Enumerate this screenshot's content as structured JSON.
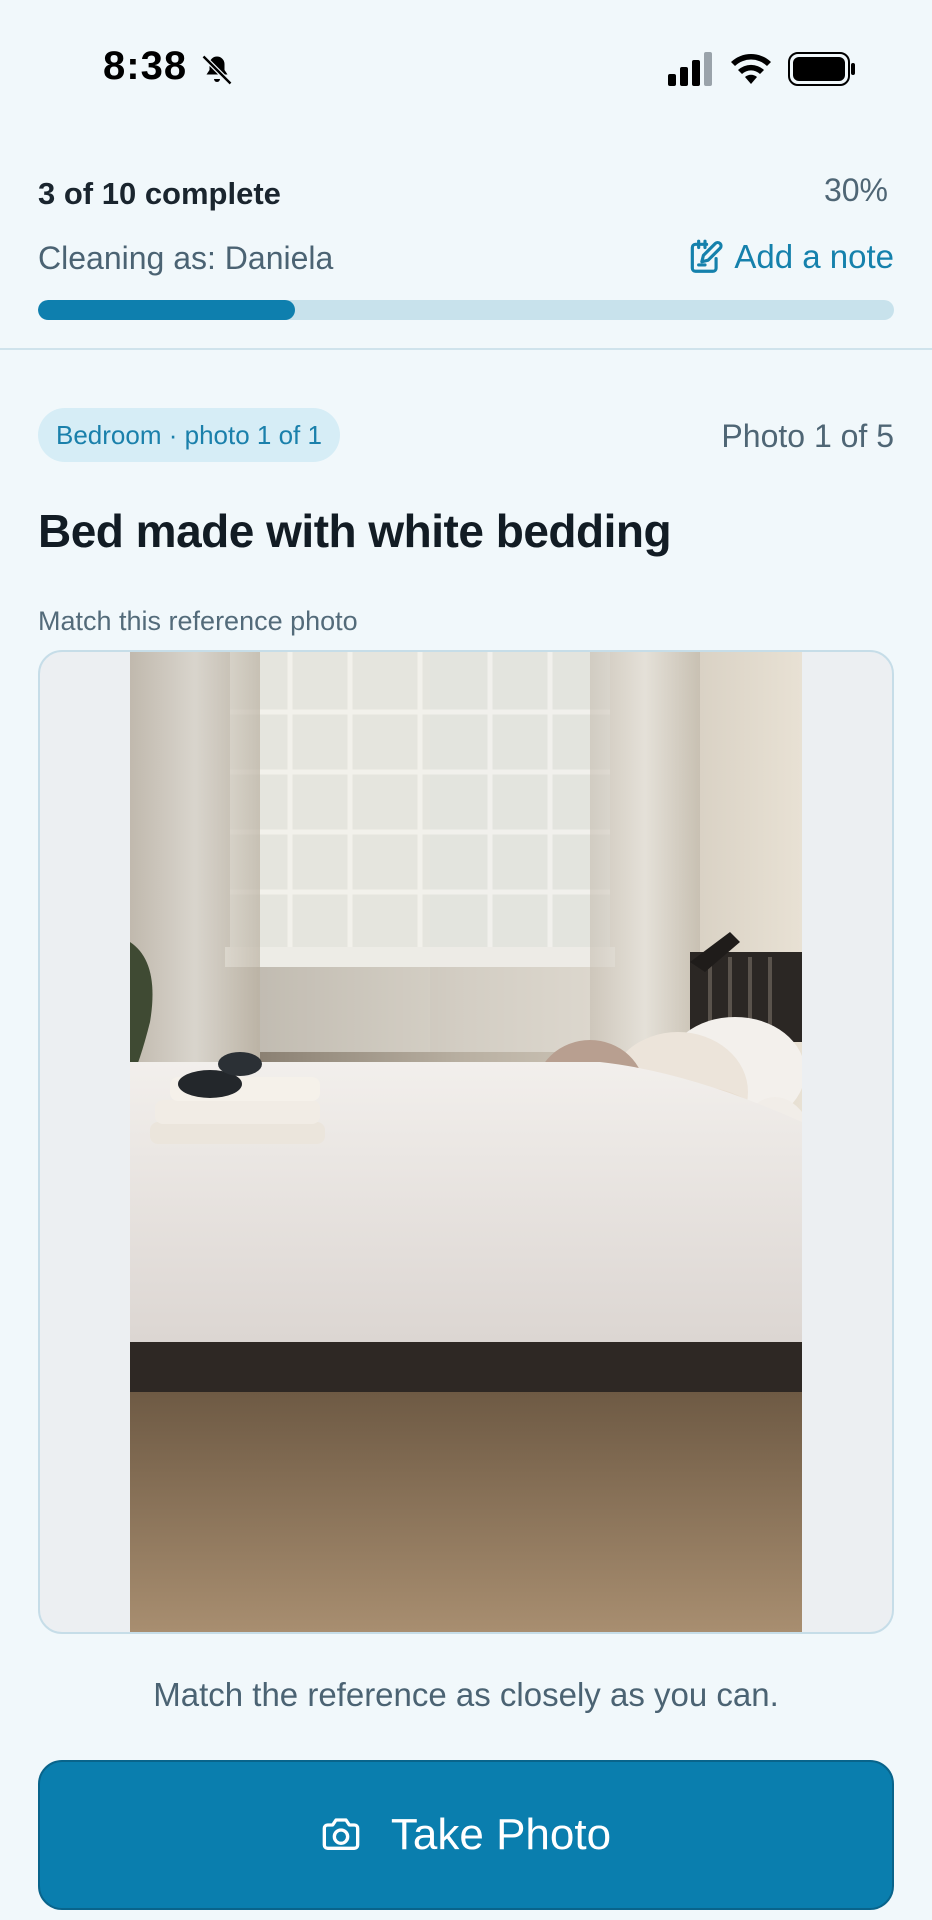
{
  "status_bar": {
    "time": "8:38",
    "icons": [
      "bell-off-icon",
      "signal-icon",
      "wifi-icon",
      "battery-icon"
    ]
  },
  "progress": {
    "complete_text": "3 of 10 complete",
    "percent_text": "30%",
    "fraction": 0.3,
    "cleaning_as": "Cleaning as: Daniela",
    "add_note_label": "Add a note"
  },
  "room": {
    "chip_label": "Bedroom · photo 1 of 1",
    "photo_count": "Photo 1 of 5",
    "task_title": "Bed made with white bedding",
    "reference_label": "Match this reference photo"
  },
  "hint": "Match the reference as closely as you can.",
  "actions": {
    "take_photo_label": "Take Photo"
  },
  "colors": {
    "accent": "#0a7eae",
    "background": "#f1f8fb",
    "progress_track": "#c8e2ec",
    "chip_bg": "#d6edf6"
  }
}
